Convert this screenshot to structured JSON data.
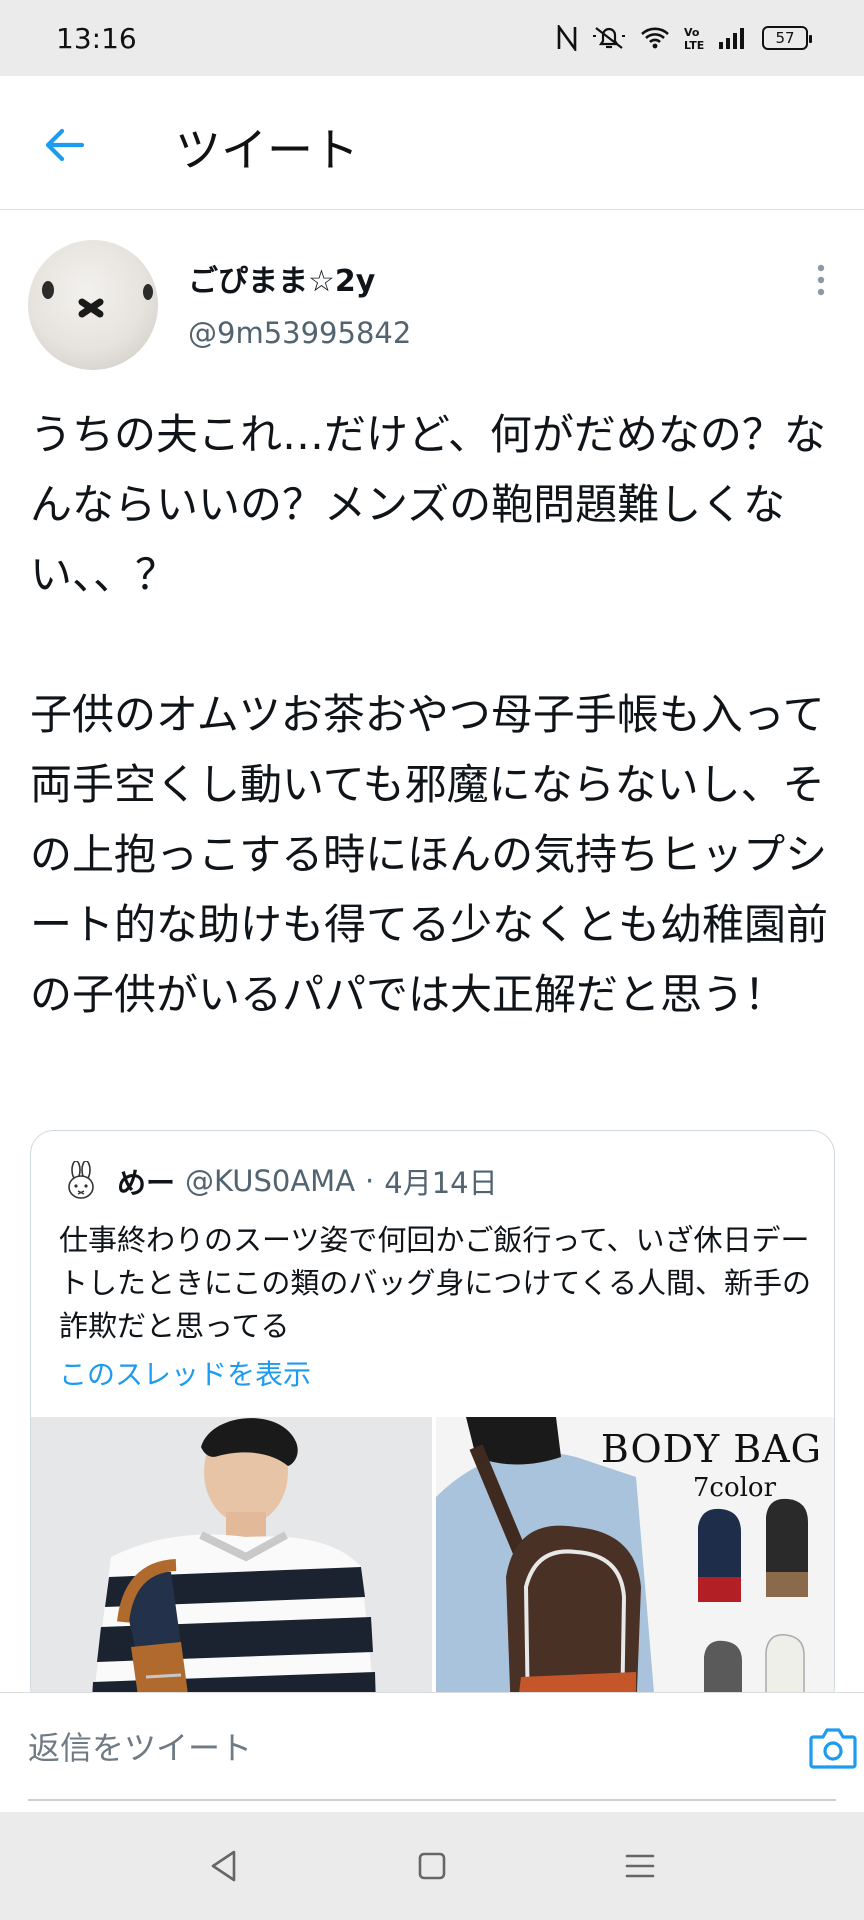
{
  "status_bar": {
    "time": "13:16",
    "battery": "57",
    "icons": [
      "nfc-icon",
      "mute-icon",
      "wifi-icon",
      "volte-icon",
      "signal-icon",
      "battery-icon"
    ]
  },
  "header": {
    "title": "ツイート",
    "back_icon": "arrow-left-icon"
  },
  "tweet": {
    "author": {
      "display_name": "ごぴまま☆2y",
      "handle": "@9m53995842"
    },
    "text": "うちの夫これ…だけど、何がだめなの？なんならいいの？メンズの鞄問題難しくない、、？\n\n子供のオムツお茶おやつ母子手帳も入って両手空くし動いても邪魔にならないし、その上抱っこする時にほんの気持ちヒップシート的な助けも得てる少なくとも幼稚園前の子供がいるパパでは大正解だと思う！",
    "quote": {
      "name": "めー",
      "handle": "@KUS0AMA",
      "separator": "·",
      "date": "4月14日",
      "text": "仕事終わりのスーツ姿で何回かご飯行って、いざ休日デートしたときにこの類のバッグ身につけてくる人間、新手の詐欺だと思ってる",
      "link": "このスレッドを表示",
      "image2_title": "BODY BAG",
      "image2_subtitle": "7color"
    }
  },
  "reply": {
    "placeholder": "返信をツイート",
    "camera_icon": "camera-icon"
  },
  "colors": {
    "accent": "#1d9bf0",
    "secondary_text": "#536471",
    "system_bar": "#ebebeb"
  }
}
